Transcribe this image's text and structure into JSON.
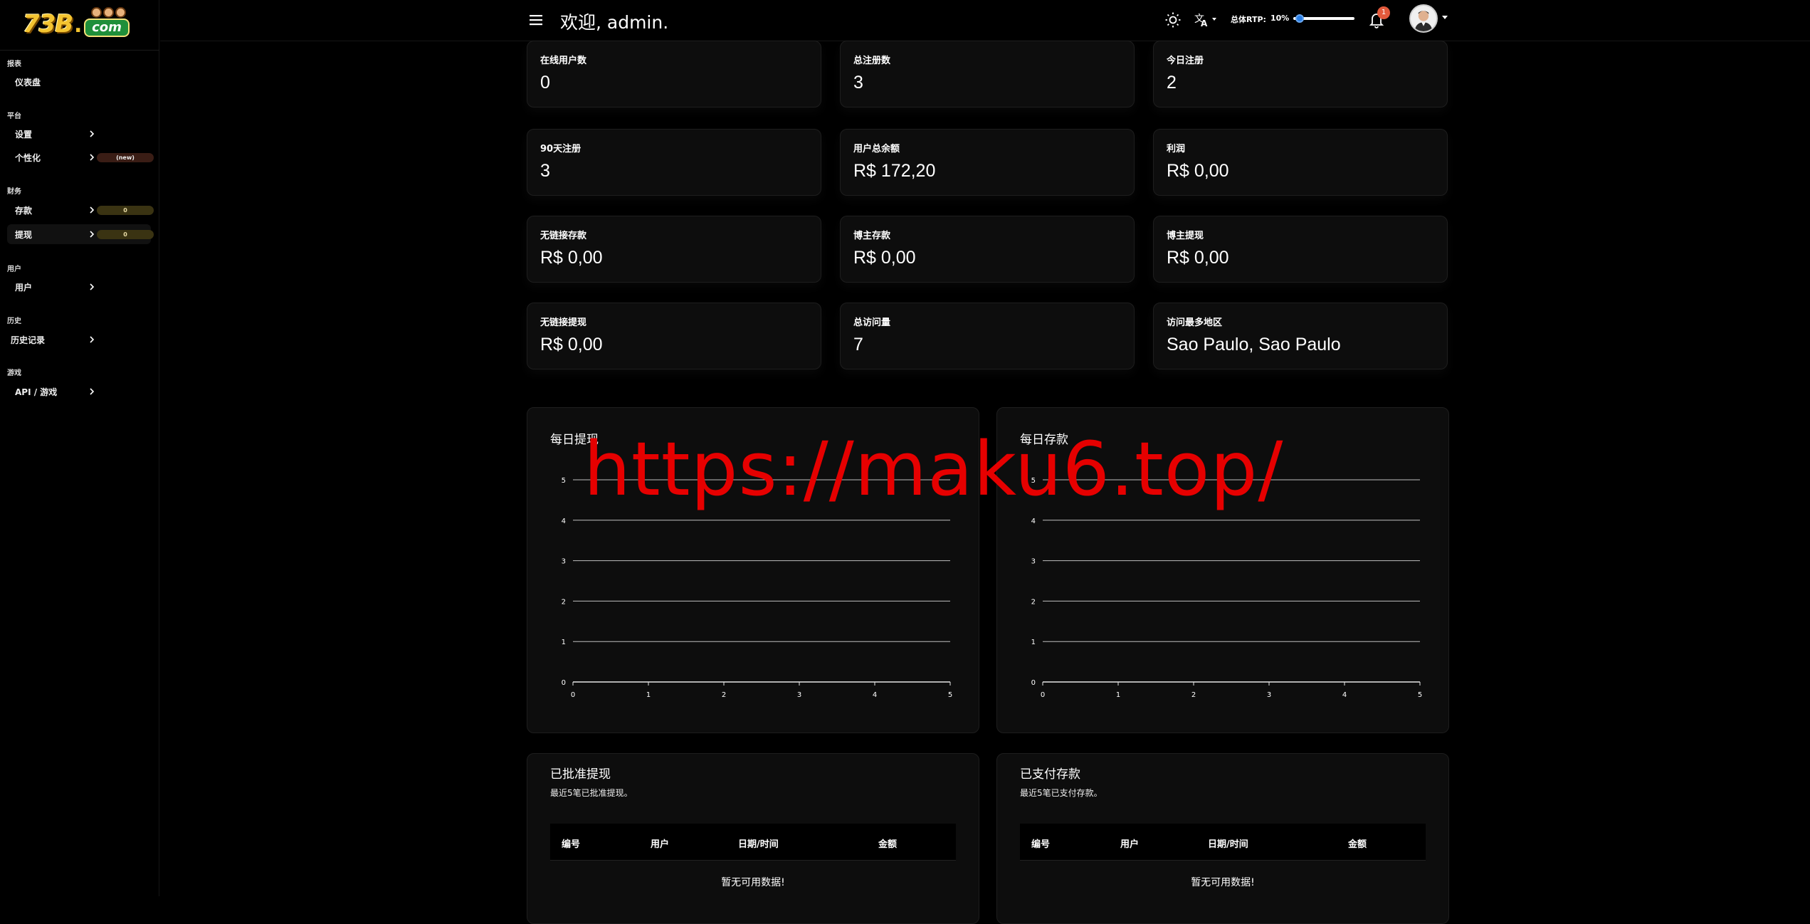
{
  "logo": {
    "num": "73B",
    "dot": ".",
    "com": "com"
  },
  "sidebar": {
    "sections": [
      {
        "title": "报表"
      },
      {
        "title": "平台"
      },
      {
        "title": "财务"
      },
      {
        "title": "用户"
      },
      {
        "title": "历史"
      },
      {
        "title": "游戏"
      }
    ],
    "items": [
      {
        "label": "仪表盘"
      },
      {
        "label": "设置"
      },
      {
        "label": "个性化",
        "badge": "(new)"
      },
      {
        "label": "存款",
        "badge": "0"
      },
      {
        "label": "提现",
        "badge": "0"
      },
      {
        "label": "用户"
      },
      {
        "label": "历史记录"
      },
      {
        "label": "API / 游戏"
      }
    ]
  },
  "header": {
    "welcome": "欢迎, admin.",
    "rtp_label": "总体RTP:",
    "rtp_value": "10%",
    "rtp_fraction": 0.1,
    "notifications": "1"
  },
  "stats": [
    {
      "title": "在线用户数",
      "value": "0"
    },
    {
      "title": "总注册数",
      "value": "3"
    },
    {
      "title": "今日注册",
      "value": "2"
    },
    {
      "title": "90天注册",
      "value": "3"
    },
    {
      "title": "用户总余额",
      "value": "R$ 172,20"
    },
    {
      "title": "利润",
      "value": "R$ 0,00"
    },
    {
      "title": "无链接存款",
      "value": "R$ 0,00"
    },
    {
      "title": "博主存款",
      "value": "R$ 0,00"
    },
    {
      "title": "博主提现",
      "value": "R$ 0,00"
    },
    {
      "title": "无链接提现",
      "value": "R$ 0,00"
    },
    {
      "title": "总访问量",
      "value": "7"
    },
    {
      "title": "访问最多地区",
      "value": "Sao Paulo, Sao Paulo"
    }
  ],
  "chart_data": [
    {
      "type": "line",
      "title": "每日提现",
      "x": [],
      "series": [],
      "xlim": [
        0,
        5
      ],
      "ylim": [
        0,
        5
      ],
      "xticks": [
        "0",
        "1",
        "2",
        "3",
        "4",
        "5"
      ],
      "yticks": [
        "0",
        "1",
        "2",
        "3",
        "4",
        "5"
      ],
      "grid": true
    },
    {
      "type": "line",
      "title": "每日存款",
      "x": [],
      "series": [],
      "xlim": [
        0,
        5
      ],
      "ylim": [
        0,
        5
      ],
      "xticks": [
        "0",
        "1",
        "2",
        "3",
        "4",
        "5"
      ],
      "yticks": [
        "0",
        "1",
        "2",
        "3",
        "4",
        "5"
      ],
      "grid": true
    }
  ],
  "tables": [
    {
      "title": "已批准提现",
      "subtitle": "最近5笔已批准提现。",
      "columns": [
        "编号",
        "用户",
        "日期/时间",
        "金额"
      ],
      "empty": "暂无可用数据!"
    },
    {
      "title": "已支付存款",
      "subtitle": "最近5笔已支付存款。",
      "columns": [
        "编号",
        "用户",
        "日期/时间",
        "金额"
      ],
      "empty": "暂无可用数据!"
    }
  ],
  "watermark": "https://maku6.top/"
}
